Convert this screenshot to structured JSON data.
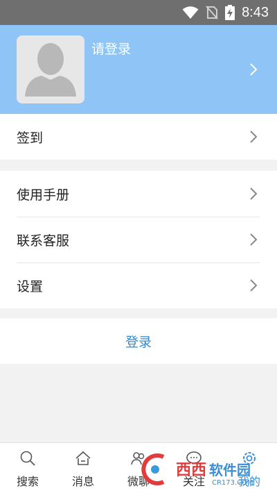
{
  "status_bar": {
    "time": "8:43",
    "icons": [
      "wifi-icon",
      "no-sim-icon",
      "battery-charging-icon"
    ]
  },
  "profile": {
    "login_prompt": "请登录",
    "avatar_icon": "default-avatar-icon",
    "chevron_icon": "chevron-right-icon"
  },
  "menu": {
    "checkin": "签到",
    "items": [
      {
        "label": "使用手册"
      },
      {
        "label": "联系客服"
      },
      {
        "label": "设置"
      }
    ]
  },
  "login_button": "登录",
  "bottom_nav": {
    "items": [
      {
        "label": "搜索",
        "icon": "search-icon",
        "active": false
      },
      {
        "label": "消息",
        "icon": "home-icon",
        "active": false
      },
      {
        "label": "微聊",
        "icon": "contacts-icon",
        "active": false
      },
      {
        "label": "关注",
        "icon": "chat-bubble-icon",
        "active": false
      },
      {
        "label": "我的",
        "icon": "gear-icon",
        "active": true
      }
    ]
  },
  "watermark": {
    "text": "西西软件园",
    "url_text": "CR173.COM"
  },
  "colors": {
    "status_bar": "#6f6f6f",
    "profile_bg": "#8ec4f6",
    "accent": "#2b8bd6",
    "active_nav": "#3a8fd8",
    "page_bg": "#f2f2f2"
  }
}
